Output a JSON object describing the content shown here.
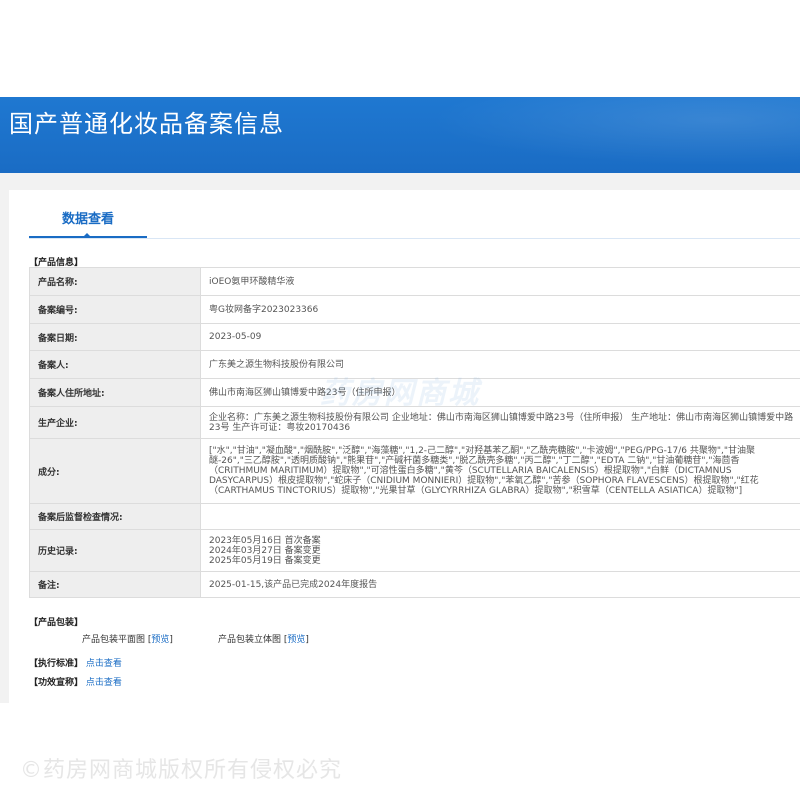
{
  "header": {
    "title": "国产普通化妆品备案信息"
  },
  "tab": {
    "label": "数据查看"
  },
  "product_info": {
    "section_title": "【产品信息】",
    "rows": [
      {
        "label": "产品名称:",
        "value": "iOEO氨甲环酸精华液"
      },
      {
        "label": "备案编号:",
        "value": "粤G妆网备字2023023366"
      },
      {
        "label": "备案日期:",
        "value": "2023-05-09"
      },
      {
        "label": "备案人:",
        "value": "广东美之源生物科技股份有限公司"
      },
      {
        "label": "备案人住所地址:",
        "value": "佛山市南海区狮山镇博爱中路23号（住所申报）"
      },
      {
        "label": "生产企业:",
        "value": "企业名称：广东美之源生物科技股份有限公司 企业地址：佛山市南海区狮山镇博爱中路23号（住所申报） 生产地址：佛山市南海区狮山镇博爱中路23号 生产许可证：粤妆20170436"
      },
      {
        "label": "成分:",
        "value": "[\"水\",\"甘油\",\"凝血酸\",\"烟酰胺\",\"泛醇\",\"海藻糖\",\"1,2-己二醇\",\"对羟基苯乙酮\",\"乙酰壳糖胺\",\"卡波姆\",\"PEG/PPG-17/6 共聚物\",\"甘油聚醚-26\",\"三乙醇胺\",\"透明质酸钠\",\"熊果苷\",\"产碱杆菌多糖类\",\"脱乙酰壳多糖\",\"丙二醇\",\"丁二醇\",\"EDTA 二钠\",\"甘油葡糖苷\",\"海茴香（CRITHMUM MARITIMUM）提取物\",\"可溶性蛋白多糖\",\"黄芩（SCUTELLARIA BAICALENSIS）根提取物\",\"白鲜（DICTAMNUS DASYCARPUS）根皮提取物\",\"蛇床子（CNIDIUM MONNIERI）提取物\",\"苯氧乙醇\",\"苦参（SOPHORA FLAVESCENS）根提取物\",\"红花（CARTHAMUS TINCTORIUS）提取物\",\"光果甘草（GLYCYRRHIZA GLABRA）提取物\",\"积雪草（CENTELLA ASIATICA）提取物\"]"
      },
      {
        "label": "备案后监督检查情况:",
        "value": ""
      },
      {
        "label": "历史记录:",
        "value": "2023年05月16日 首次备案\n2024年03月27日 备案变更\n2025年05月19日 备案变更"
      },
      {
        "label": "备注:",
        "value": "2025-01-15,该产品已完成2024年度报告"
      }
    ]
  },
  "packaging": {
    "section_title": "【产品包装】",
    "flat_label": "产品包装平面图",
    "solid_label": "产品包装立体图",
    "bracket_open": "[",
    "bracket_close": "]",
    "preview_label": "预览"
  },
  "standard": {
    "section_title": "【执行标准】",
    "link": "点击查看"
  },
  "efficacy": {
    "section_title": "【功效宣称】",
    "link": "点击查看"
  },
  "watermarks": {
    "center": "药房网商城",
    "bottom": "©药房网商城版权所有侵权必究"
  },
  "colors": {
    "banner": "#1a6cc4",
    "accent": "#1a6cc4",
    "label_bg": "#eeeeee"
  }
}
